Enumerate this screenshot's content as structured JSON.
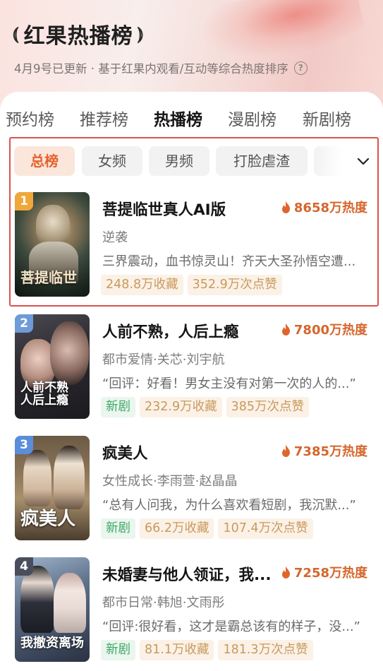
{
  "header": {
    "title": "红果热播榜",
    "subtitle": "4月9号已更新 · 基于红果内观看/互动等综合热度排序"
  },
  "tabs": [
    {
      "label": "预约榜",
      "active": false
    },
    {
      "label": "推荐榜",
      "active": false
    },
    {
      "label": "热播榜",
      "active": true
    },
    {
      "label": "漫剧榜",
      "active": false
    },
    {
      "label": "新剧榜",
      "active": false
    }
  ],
  "filters": [
    {
      "label": "总榜",
      "active": true
    },
    {
      "label": "女频",
      "active": false
    },
    {
      "label": "男频",
      "active": false
    },
    {
      "label": "打脸虐渣",
      "active": false
    }
  ],
  "items": [
    {
      "rank": "1",
      "rank_color": "#f0a73a",
      "poster_text": "菩提临世",
      "title": "菩提临世真人AI版",
      "heat": "8658万热度",
      "genre": "逆袭",
      "desc": "三界震动，血书惊灵山！齐天大圣孙悟空遭...",
      "tags": [
        "248.8万收藏",
        "352.9万次点赞"
      ],
      "is_new": false
    },
    {
      "rank": "2",
      "rank_color": "#6f9bd8",
      "poster_text": "人前不熟\n人后上瘾",
      "title": "人前不熟，人后上瘾",
      "heat": "7800万热度",
      "genre": "都市爱情·关芯·刘宇航",
      "desc": "“回评：好看！男女主没有对第一次的人的...”",
      "tags": [
        "232.9万收藏",
        "385万次点赞"
      ],
      "is_new": true,
      "new_label": "新剧"
    },
    {
      "rank": "3",
      "rank_color": "#5a8ddb",
      "poster_text": "疯美人",
      "title": "疯美人",
      "heat": "7385万热度",
      "genre": "女性成长·李雨萱·赵晶晶",
      "desc": "“总有人问我，为什么喜欢看短剧，我沉默...”",
      "tags": [
        "66.2万收藏",
        "107.4万次点赞"
      ],
      "is_new": true,
      "new_label": "新剧"
    },
    {
      "rank": "4",
      "rank_color": "#4a4e5c",
      "poster_text": "我撤资离场",
      "title": "未婚妻与他人领证，我...",
      "heat": "7258万热度",
      "genre": "都市日常·韩旭·文雨彤",
      "desc": "“回评:很好看，这才是霸总该有的样子，没...”",
      "tags": [
        "81.1万收藏",
        "181.3万次点赞"
      ],
      "is_new": true,
      "new_label": "新剧"
    }
  ]
}
